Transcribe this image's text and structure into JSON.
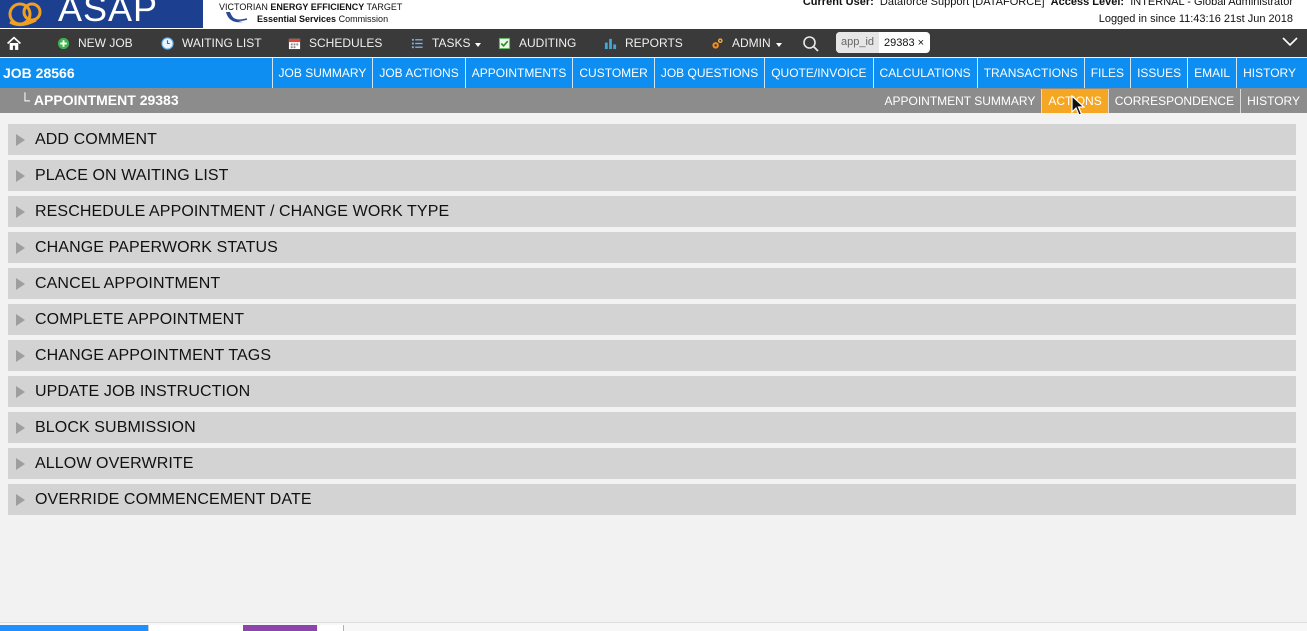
{
  "header": {
    "logo_text": "ASAP",
    "veet_line1_prefix": "VICTORIAN ",
    "veet_line1_bold": "ENERGY EFFICIENCY",
    "veet_line1_suffix": " TARGET",
    "veet_line2_bold": "Essential Services",
    "veet_line2_rest": " Commission",
    "current_user_label": "Current User:",
    "current_user_value": "Dataforce Support [DATAFORCE]",
    "access_level_label": "Access Level:",
    "access_level_value": "INTERNAL - Global Administrator",
    "logged_in_text": "Logged in since 11:43:16 21st Jun 2018"
  },
  "nav": {
    "items": [
      {
        "label": "NEW JOB",
        "icon": "plus-circle-icon"
      },
      {
        "label": "WAITING LIST",
        "icon": "clock-icon"
      },
      {
        "label": "SCHEDULES",
        "icon": "calendar-icon"
      },
      {
        "label": "TASKS",
        "icon": "list-icon"
      },
      {
        "label": "AUDITING",
        "icon": "checkbox-icon"
      },
      {
        "label": "REPORTS",
        "icon": "bar-chart-icon"
      },
      {
        "label": "ADMIN",
        "icon": "gears-icon"
      }
    ],
    "filter_chip": {
      "key": "app_id",
      "value": "29383",
      "remove": "×"
    }
  },
  "job": {
    "title": "JOB 28566",
    "tabs": [
      "JOB SUMMARY",
      "JOB ACTIONS",
      "APPOINTMENTS",
      "CUSTOMER",
      "JOB QUESTIONS",
      "QUOTE/INVOICE",
      "CALCULATIONS",
      "TRANSACTIONS",
      "FILES",
      "ISSUES",
      "EMAIL",
      "HISTORY"
    ]
  },
  "appointment": {
    "elbow": "└",
    "title": "APPOINTMENT 29383",
    "tabs": [
      "APPOINTMENT SUMMARY",
      "ACTIONS",
      "CORRESPONDENCE",
      "HISTORY"
    ],
    "active_tab": "ACTIONS"
  },
  "actions": [
    "ADD COMMENT",
    "PLACE ON WAITING LIST",
    "RESCHEDULE APPOINTMENT / CHANGE WORK TYPE",
    "CHANGE PAPERWORK STATUS",
    "CANCEL APPOINTMENT",
    "COMPLETE APPOINTMENT",
    "CHANGE APPOINTMENT TAGS",
    "UPDATE JOB INSTRUCTION",
    "BLOCK SUBMISSION",
    "ALLOW OVERWRITE",
    "OVERRIDE COMMENCEMENT DATE"
  ],
  "colors": {
    "job_bar": "#0d8ef0",
    "appointment_bar": "#8c8c8c",
    "active_tab": "#f5a623",
    "nav_bar": "#3a3a3a",
    "logo_bg": "#1d3f8f"
  }
}
